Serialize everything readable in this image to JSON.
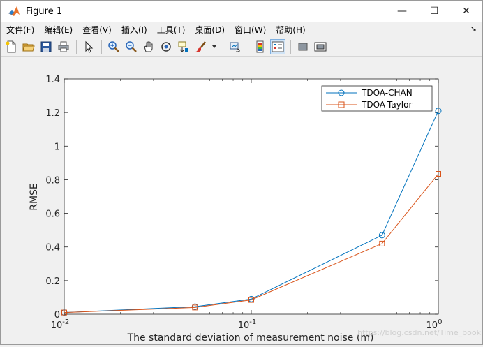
{
  "window": {
    "title": "Figure 1"
  },
  "controls": {
    "minimize": "—",
    "maximize": "☐",
    "close": "✕"
  },
  "menu": {
    "items": [
      "文件(F)",
      "编辑(E)",
      "查看(V)",
      "插入(I)",
      "工具(T)",
      "桌面(D)",
      "窗口(W)",
      "帮助(H)"
    ],
    "more": "↘"
  },
  "toolbar": {
    "icons": [
      "new-file-icon",
      "open-folder-icon",
      "save-icon",
      "print-icon",
      "pointer-icon",
      "zoom-in-icon",
      "zoom-out-icon",
      "pan-hand-icon",
      "rotate-3d-icon",
      "data-cursor-icon",
      "brush-icon",
      "link-plot-icon",
      "colorbar-icon",
      "legend-icon",
      "hide-plot-tools-icon",
      "show-plot-tools-icon"
    ]
  },
  "watermark": "https://blog.csdn.net/Time_book",
  "chart_data": {
    "type": "line",
    "xscale": "log",
    "xlim": [
      0.01,
      1
    ],
    "ylim": [
      0,
      1.4
    ],
    "xlabel": "The standard deviation of measurement noise (m)",
    "ylabel": "RMSE",
    "xticks": [
      {
        "value": 0.01,
        "base": "10",
        "exp": "-2"
      },
      {
        "value": 0.1,
        "base": "10",
        "exp": "-1"
      },
      {
        "value": 1,
        "base": "10",
        "exp": "0"
      }
    ],
    "yticks": [
      "0",
      "0.2",
      "0.4",
      "0.6",
      "0.8",
      "1",
      "1.2",
      "1.4"
    ],
    "legend_position": "top-right",
    "series": [
      {
        "name": "TDOA-CHAN",
        "color": "#0072bd",
        "marker": "circle",
        "x": [
          0.01,
          0.05,
          0.1,
          0.5,
          1
        ],
        "y": [
          0.01,
          0.045,
          0.09,
          0.47,
          1.21
        ]
      },
      {
        "name": "TDOA-Taylor",
        "color": "#d95319",
        "marker": "square",
        "x": [
          0.01,
          0.05,
          0.1,
          0.5,
          1
        ],
        "y": [
          0.01,
          0.04,
          0.085,
          0.42,
          0.835
        ]
      }
    ]
  }
}
